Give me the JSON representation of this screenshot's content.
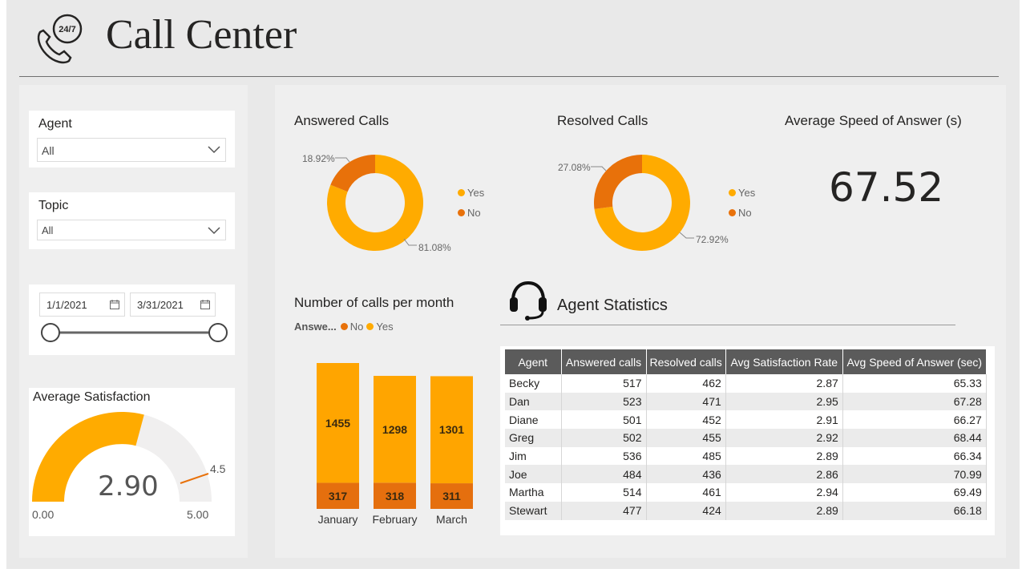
{
  "header": {
    "title": "Call Center",
    "icon_text": "24/7"
  },
  "filters": {
    "agent": {
      "label": "Agent",
      "value": "All"
    },
    "topic": {
      "label": "Topic",
      "value": "All"
    },
    "date_range": {
      "start": "1/1/2021",
      "end": "3/31/2021"
    }
  },
  "avg_satisfaction": {
    "title": "Average Satisfaction",
    "value": "2.90",
    "min": "0.00",
    "max": "5.00",
    "target": "4.5"
  },
  "answered_calls": {
    "title": "Answered Calls",
    "yes_pct": "81.08%",
    "no_pct": "18.92%",
    "legend_yes": "Yes",
    "legend_no": "No"
  },
  "resolved_calls": {
    "title": "Resolved Calls",
    "yes_pct": "72.92%",
    "no_pct": "27.08%",
    "legend_yes": "Yes",
    "legend_no": "No"
  },
  "avg_speed": {
    "title": "Average Speed of Answer (s)",
    "value": "67.52"
  },
  "calls_per_month": {
    "title": "Number of calls per month",
    "legend_title": "Answe...",
    "legend_no": "No",
    "legend_yes": "Yes"
  },
  "agent_stats": {
    "title": "Agent Statistics",
    "columns": [
      "Agent",
      "Answered calls",
      "Resolved calls",
      "Avg Satisfaction Rate",
      "Avg Speed of Answer (sec)"
    ],
    "rows": [
      [
        "Becky",
        "517",
        "462",
        "2.87",
        "65.33"
      ],
      [
        "Dan",
        "523",
        "471",
        "2.95",
        "67.28"
      ],
      [
        "Diane",
        "501",
        "452",
        "2.91",
        "66.27"
      ],
      [
        "Greg",
        "502",
        "455",
        "2.92",
        "68.44"
      ],
      [
        "Jim",
        "536",
        "485",
        "2.89",
        "66.34"
      ],
      [
        "Joe",
        "484",
        "436",
        "2.86",
        "70.99"
      ],
      [
        "Martha",
        "514",
        "461",
        "2.94",
        "69.49"
      ],
      [
        "Stewart",
        "477",
        "424",
        "2.89",
        "66.18"
      ]
    ]
  },
  "colors": {
    "yes": "#FFAB00",
    "no": "#E8710A",
    "bar_yes": "#FFA500",
    "bar_no": "#E56F0E",
    "header_row": "#5B5B5B"
  },
  "chart_data": [
    {
      "type": "pie",
      "title": "Answered Calls",
      "categories": [
        "Yes",
        "No"
      ],
      "values": [
        81.08,
        18.92
      ]
    },
    {
      "type": "pie",
      "title": "Resolved Calls",
      "categories": [
        "Yes",
        "No"
      ],
      "values": [
        72.92,
        27.08
      ]
    },
    {
      "type": "bar",
      "stacked": true,
      "title": "Number of calls per month",
      "categories": [
        "January",
        "February",
        "March"
      ],
      "series": [
        {
          "name": "No",
          "values": [
            317,
            318,
            311
          ]
        },
        {
          "name": "Yes",
          "values": [
            1455,
            1298,
            1301
          ]
        }
      ],
      "ylim": [
        0,
        1772
      ]
    }
  ]
}
